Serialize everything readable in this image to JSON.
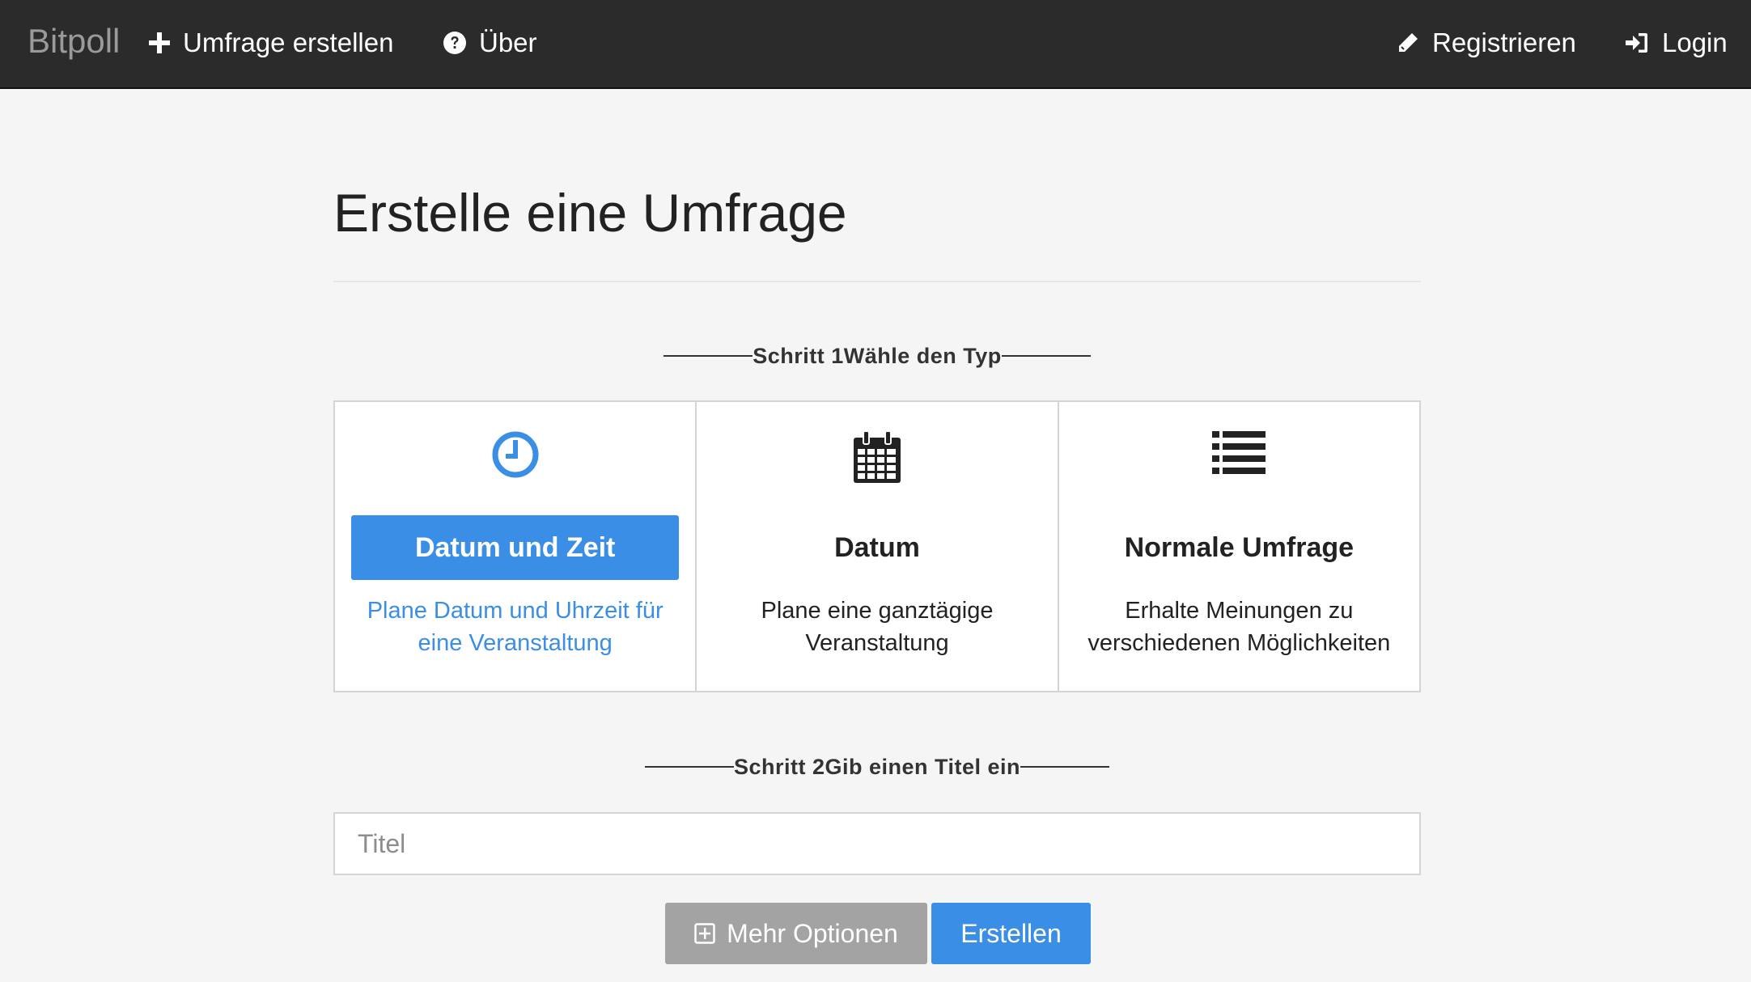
{
  "navbar": {
    "brand": "Bitpoll",
    "create_label": "Umfrage erstellen",
    "about_label": "Über",
    "register_label": "Registrieren",
    "login_label": "Login"
  },
  "main": {
    "title": "Erstelle eine Umfrage",
    "step1": {
      "label": "Schritt 1",
      "text": "Wähle den Typ"
    },
    "types": [
      {
        "label": "Datum und Zeit",
        "desc_line1": "Plane Datum und Uhrzeit für",
        "desc_line2": "eine Veranstaltung",
        "icon": "clock-icon",
        "active": true
      },
      {
        "label": "Datum",
        "desc_line1": "Plane eine ganztägige",
        "desc_line2": "Veranstaltung",
        "icon": "calendar-icon",
        "active": false
      },
      {
        "label": "Normale Umfrage",
        "desc_line1": "Erhalte Meinungen zu",
        "desc_line2": "verschiedenen Möglichkeiten",
        "icon": "list-icon",
        "active": false
      }
    ],
    "step2": {
      "label": "Schritt 2",
      "text": "Gib einen Titel ein"
    },
    "title_input": {
      "placeholder": "Titel",
      "value": ""
    },
    "more_options_label": "Mehr Optionen",
    "create_button_label": "Erstellen"
  },
  "colors": {
    "accent": "#3a8ee6",
    "navbar_bg": "#2b2b2b",
    "secondary_button": "#a3a3a3"
  }
}
